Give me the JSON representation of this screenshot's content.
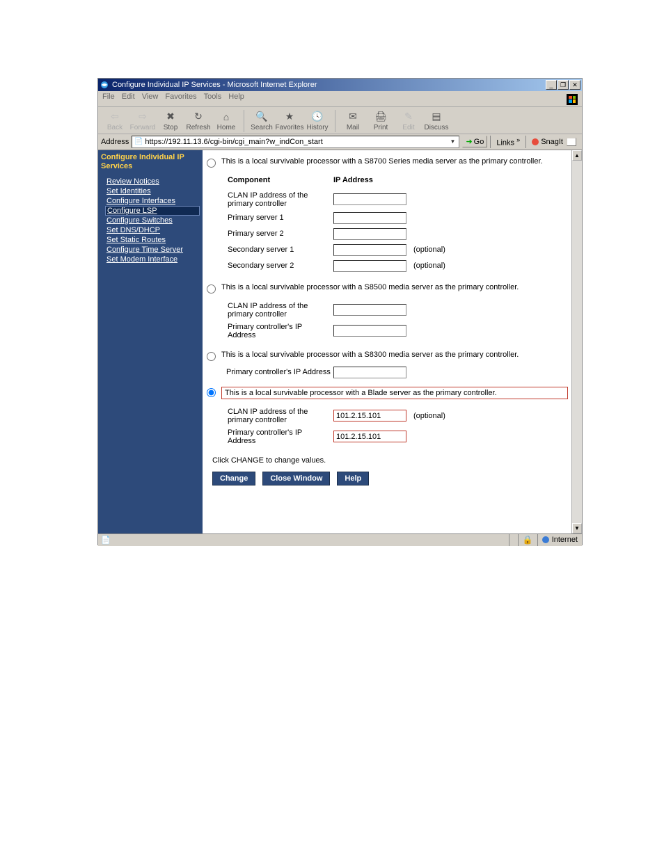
{
  "titlebar": {
    "title": "Configure Individual IP Services - Microsoft Internet Explorer"
  },
  "menubar": {
    "file": "File",
    "edit": "Edit",
    "view": "View",
    "favorites": "Favorites",
    "tools": "Tools",
    "help": "Help"
  },
  "toolbar": {
    "back": "Back",
    "forward": "Forward",
    "stop": "Stop",
    "refresh": "Refresh",
    "home": "Home",
    "search": "Search",
    "favorites": "Favorites",
    "history": "History",
    "mail": "Mail",
    "print": "Print",
    "editbtn": "Edit",
    "discuss": "Discuss"
  },
  "address": {
    "label": "Address",
    "value": "https://192.11.13.6/cgi-bin/cgi_main?w_indCon_start",
    "go": "Go",
    "links": "Links",
    "snagit": "SnagIt"
  },
  "sidebar": {
    "title": "Configure Individual IP Services",
    "items": [
      "Review Notices",
      "Set Identities",
      "Configure Interfaces",
      "Configure LSP",
      "Configure Switches",
      "Set DNS/DHCP",
      "Set Static Routes",
      "Configure Time Server",
      "Set Modem Interface"
    ],
    "selected_index": 3
  },
  "form": {
    "opt1": "This is a local survivable processor with a S8700 Series media server as the primary controller.",
    "table1": {
      "h1": "Component",
      "h2": "IP Address",
      "rows": [
        {
          "lbl": "CLAN IP address of the primary controller",
          "opt": ""
        },
        {
          "lbl": "Primary server 1",
          "opt": ""
        },
        {
          "lbl": "Primary server 2",
          "opt": ""
        },
        {
          "lbl": "Secondary server 1",
          "opt": "(optional)"
        },
        {
          "lbl": "Secondary server 2",
          "opt": "(optional)"
        }
      ]
    },
    "opt2": "This is a local survivable processor with a S8500 media server as the primary controller.",
    "table2": {
      "rows": [
        {
          "lbl": "CLAN IP address of the primary controller"
        },
        {
          "lbl": "Primary controller's IP Address"
        }
      ]
    },
    "opt3": "This is a local survivable processor with a S8300 media server as the primary controller.",
    "inline3": "Primary controller's IP Address",
    "opt4": "This is a local survivable processor with a Blade server as the primary controller.",
    "table4": {
      "rows": [
        {
          "lbl": "CLAN IP address of the primary controller",
          "val": "101.2.15.101",
          "opt": "(optional)"
        },
        {
          "lbl": "Primary controller's IP Address",
          "val": "101.2.15.101",
          "opt": ""
        }
      ]
    },
    "instruction": "Click CHANGE to change values.",
    "change": "Change",
    "close": "Close Window",
    "help": "Help"
  },
  "status": {
    "zone": "Internet"
  }
}
